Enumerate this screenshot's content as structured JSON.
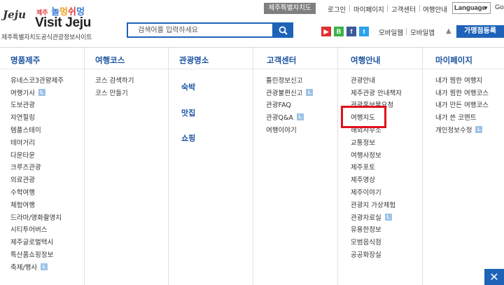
{
  "logo": {
    "script": "Jeju",
    "ko_small": "제주",
    "ko_1": "놀",
    "ko_2": "멍",
    "ko_3": "쉬",
    "ko_4": "멍",
    "en": "Visit Jeju",
    "subtitle": "제주특별자치도공식관광정보사이트"
  },
  "search": {
    "placeholder": "검색어를 입력하세요"
  },
  "topbar": {
    "badge": "제주특별자치도",
    "links": [
      "로그인",
      "마이페이지",
      "고객센터",
      "여행안내"
    ],
    "language_value": "Language",
    "go_label": "Go"
  },
  "sns": [
    "▶",
    "B",
    "f",
    "t"
  ],
  "mobile": {
    "web": "모바일웹",
    "app": "모바일앱"
  },
  "register_button": "가맹점등록",
  "colors": {
    "accent": "#1e63b8",
    "title": "#1a53a0",
    "highlight": "#e0101a",
    "badge": "#9dc3e6"
  },
  "menu": [
    {
      "title": "명품제주",
      "items": [
        {
          "label": "유네스코3관왕제주"
        },
        {
          "label": "여행기사",
          "badge": "L"
        },
        {
          "label": "도보관광"
        },
        {
          "label": "자연힐링"
        },
        {
          "label": "템플스테이"
        },
        {
          "label": "테마거리"
        },
        {
          "label": "다운타운"
        },
        {
          "label": "크루즈관광"
        },
        {
          "label": "의료관광"
        },
        {
          "label": "수학여행"
        },
        {
          "label": "체험여행"
        },
        {
          "label": "드라마/영화촬영지"
        },
        {
          "label": "시티투어버스"
        },
        {
          "label": "제주글로벌택시"
        },
        {
          "label": "특산품쇼핑정보"
        },
        {
          "label": "축제/행사",
          "badge": "L"
        }
      ]
    },
    {
      "title": "여행코스",
      "items": [
        {
          "label": "코스 검색하기"
        },
        {
          "label": "코스 만들기"
        }
      ]
    },
    {
      "title": "관광명소",
      "big_items": [
        "숙박",
        "맛집",
        "쇼핑"
      ]
    },
    {
      "title": "고객센터",
      "items": [
        {
          "label": "틀린정보신고"
        },
        {
          "label": "관광불편신고",
          "badge": "L"
        },
        {
          "label": "관광FAQ"
        },
        {
          "label": "관광Q&A",
          "badge": "L"
        },
        {
          "label": "여행이야기"
        }
      ]
    },
    {
      "title": "여행안내",
      "items": [
        {
          "label": "관광안내"
        },
        {
          "label": "제주관광 안내책자"
        },
        {
          "label": "관광홍보물요청"
        },
        {
          "label": "여행지도"
        },
        {
          "label": "해외사무소"
        },
        {
          "label": "교통정보"
        },
        {
          "label": "여행사정보"
        },
        {
          "label": "제주포토"
        },
        {
          "label": "제주영상"
        },
        {
          "label": "제주이야기"
        },
        {
          "label": "관광지 가상체험"
        },
        {
          "label": "관광자료실",
          "badge": "L"
        },
        {
          "label": "유용한정보"
        },
        {
          "label": "모범음식점"
        },
        {
          "label": "공공화장실"
        }
      ]
    },
    {
      "title": "마이페이지",
      "items": [
        {
          "label": "내가 찜한 여행지"
        },
        {
          "label": "내가 찜한 여행코스"
        },
        {
          "label": "내가 만든 여행코스"
        },
        {
          "label": "내가 쓴 코멘트"
        },
        {
          "label": "개인정보수정",
          "badge": "L"
        }
      ]
    }
  ],
  "close_label": "✕"
}
